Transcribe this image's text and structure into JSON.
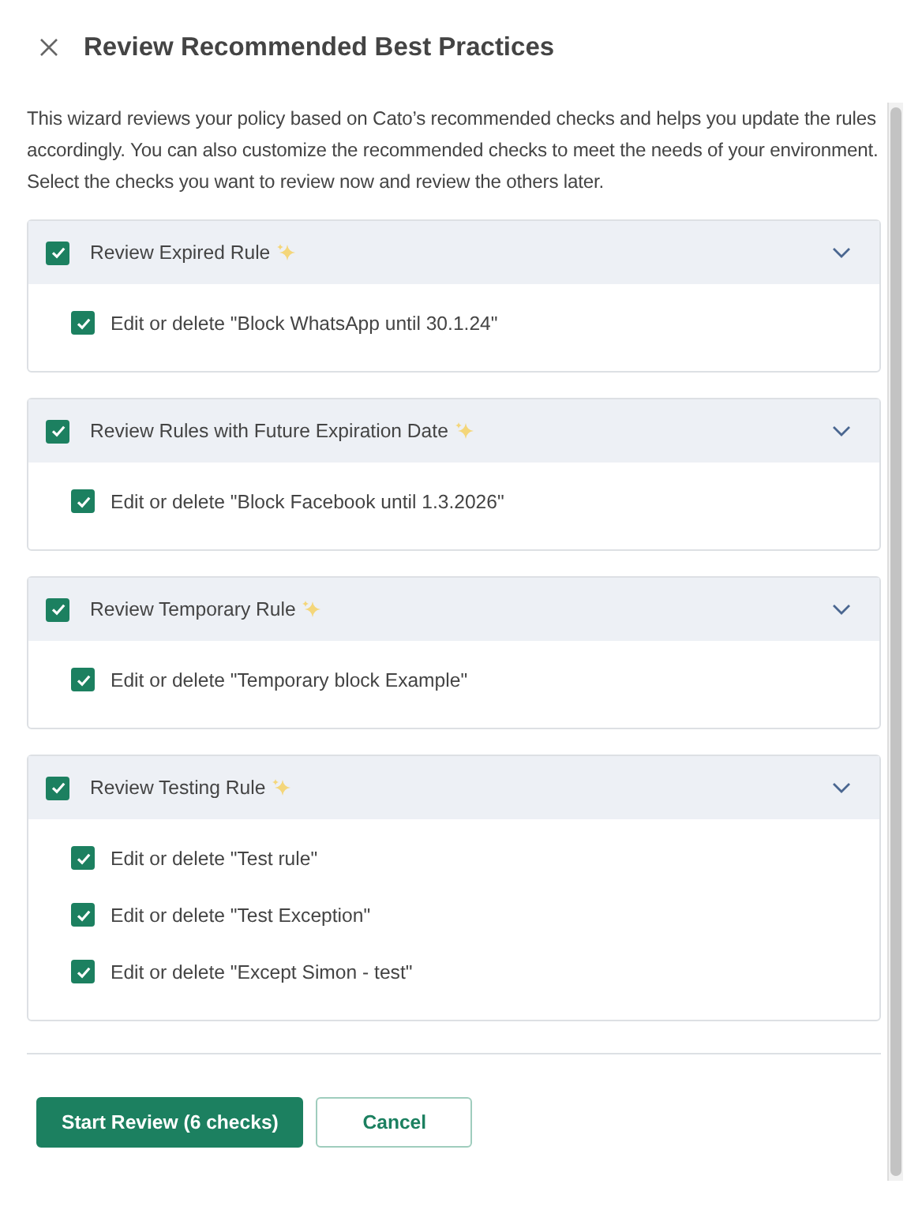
{
  "dialog": {
    "title": "Review Recommended Best Practices"
  },
  "description": "This wizard reviews your policy based on Cato’s recommended checks and helps you update the rules accordingly. You can also customize the recommended checks to meet the needs of your environment. Select the checks you want to review now and review the others later.",
  "groups": [
    {
      "label": "Review Expired Rule",
      "checked": true,
      "expanded": true,
      "items": [
        {
          "label": "Edit or delete \"Block WhatsApp until 30.1.24\"",
          "checked": true
        }
      ]
    },
    {
      "label": "Review Rules with Future Expiration Date",
      "checked": true,
      "expanded": true,
      "items": [
        {
          "label": "Edit or delete \"Block Facebook until 1.3.2026\"",
          "checked": true
        }
      ]
    },
    {
      "label": "Review Temporary Rule",
      "checked": true,
      "expanded": true,
      "items": [
        {
          "label": "Edit or delete \"Temporary block Example\"",
          "checked": true
        }
      ]
    },
    {
      "label": "Review Testing Rule",
      "checked": true,
      "expanded": true,
      "items": [
        {
          "label": "Edit or delete \"Test rule\"",
          "checked": true
        },
        {
          "label": "Edit or delete \"Test Exception\"",
          "checked": true
        },
        {
          "label": "Edit or delete \"Except Simon - test\"",
          "checked": true
        }
      ]
    }
  ],
  "buttons": [
    {
      "label": "Start Review (6 checks)",
      "kind": "primary"
    },
    {
      "label": "Cancel",
      "kind": "secondary"
    }
  ]
}
